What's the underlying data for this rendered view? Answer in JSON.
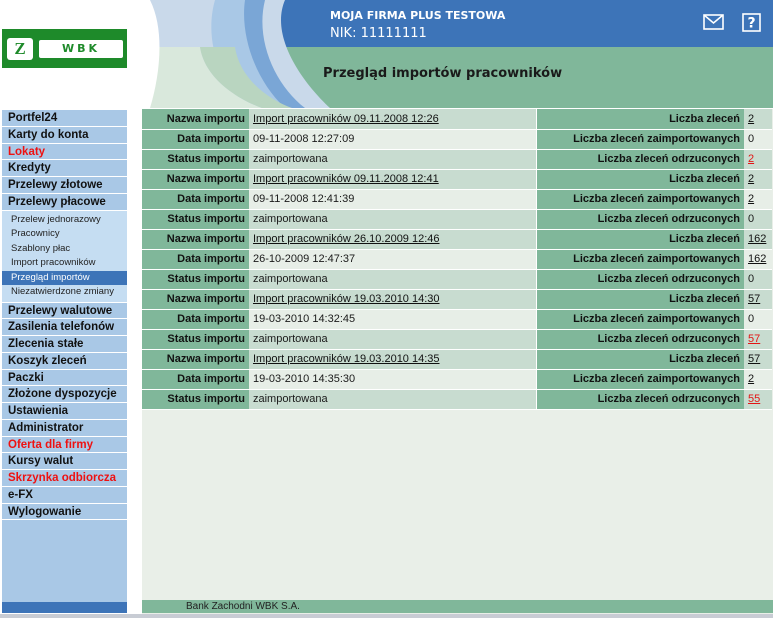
{
  "header": {
    "company_name": "MOJA FIRMA PLUS TESTOWA",
    "nik": "NIK: 11111111",
    "page_title": "Przegląd importów pracowników",
    "logo_text": "WBK",
    "colors": {
      "brand_green": "#1e8a2a",
      "header_blue": "#3d74b8",
      "table_label": "#80b79a"
    }
  },
  "sidebar": {
    "before": [
      {
        "label": "Portfel24"
      },
      {
        "label": "Karty do konta"
      },
      {
        "label": "Lokaty"
      },
      {
        "label": "Kredyty"
      },
      {
        "label": "Przelewy złotowe"
      },
      {
        "label": "Przelewy płacowe"
      }
    ],
    "sub_items": [
      {
        "label": "Przelew jednorazowy"
      },
      {
        "label": "Pracownicy"
      },
      {
        "label": "Szablony płac"
      },
      {
        "label": "Import pracowników"
      },
      {
        "label": "Przegląd importów"
      },
      {
        "label": "Niezatwierdzone zmiany"
      }
    ],
    "after": [
      {
        "label": "Przelewy walutowe"
      },
      {
        "label": "Zasilenia telefonów"
      },
      {
        "label": "Zlecenia stałe"
      },
      {
        "label": "Koszyk zleceń"
      },
      {
        "label": "Paczki"
      },
      {
        "label": "Złożone dyspozycje"
      },
      {
        "label": "Ustawienia"
      },
      {
        "label": "Administrator"
      },
      {
        "label": "Oferta dla firmy"
      },
      {
        "label": "Kursy walut"
      },
      {
        "label": "Skrzynka odbiorcza"
      },
      {
        "label": "e-FX"
      },
      {
        "label": "Wylogowanie"
      }
    ]
  },
  "labels": {
    "name": "Nazwa importu",
    "date": "Data importu",
    "status": "Status importu",
    "orders": "Liczba zleceń",
    "imported": "Liczba zleceń zaimportowanych",
    "rejected": "Liczba zleceń odrzuconych"
  },
  "imports": [
    {
      "name": "Import pracowników 09.11.2008 12:26",
      "date": "09-11-2008 12:27:09",
      "status": "zaimportowana",
      "orders": "2",
      "imported": "0",
      "rejected": "2"
    },
    {
      "name": "Import pracowników 09.11.2008 12:41",
      "date": "09-11-2008 12:41:39",
      "status": "zaimportowana",
      "orders": "2",
      "imported": "2",
      "rejected": "0"
    },
    {
      "name": "Import pracowników 26.10.2009 12:46",
      "date": "26-10-2009 12:47:37",
      "status": "zaimportowana",
      "orders": "162",
      "imported": "162",
      "rejected": "0"
    },
    {
      "name": "Import pracowników 19.03.2010 14:30",
      "date": "19-03-2010 14:32:45",
      "status": "zaimportowana",
      "orders": "57",
      "imported": "0",
      "rejected": "57"
    },
    {
      "name": "Import pracowników 19.03.2010 14:35",
      "date": "19-03-2010 14:35:30",
      "status": "zaimportowana",
      "orders": "57",
      "imported": "2",
      "rejected": "55"
    }
  ],
  "footer": {
    "text": "Bank Zachodni WBK S.A."
  },
  "icons": {
    "mail": "envelope-icon",
    "help": "question-mark-icon"
  }
}
